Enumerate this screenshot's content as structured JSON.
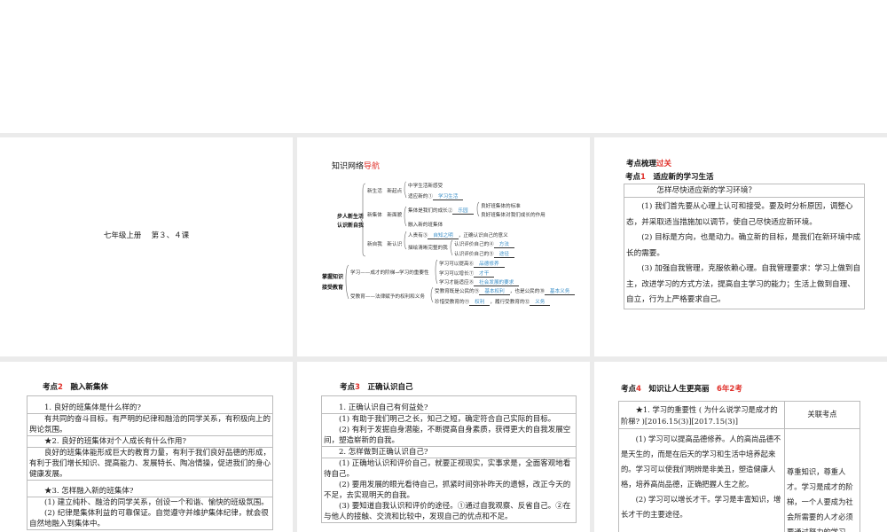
{
  "slides": [
    {
      "title": "七年级上册　 第３、４课"
    },
    {
      "title_a": "知识网络",
      "title_b": "导航",
      "mindmap": {
        "root1": [
          "步人新生活",
          "认识新自我"
        ],
        "b1": "新生活　新起点",
        "b1a": "中学生活新感受",
        "b1b": "适应新的①",
        "b1b_blank": "学习生活",
        "b2": "新集体　新面貌",
        "b2a": "集体是我们的成长②",
        "b2a_blank": "乐园",
        "b2a1": "良好班集体的标准",
        "b2a2": "良好班集体对我们成长的作用",
        "b2b": "融入新的班集体",
        "b3": "新自我　新认识",
        "b3a": "人贵有③",
        "b3a_blank": "自知之明",
        "b3a_tail": "，正确认识自己的意义",
        "b3b": "描绘清晰完整的我",
        "b3b1": "认识评价自己的④",
        "b3b1_blank": "方法",
        "b3b2": "认识评价自己的⑤",
        "b3b2_blank": "途径",
        "root2": [
          "掌握知识",
          "接受教育"
        ],
        "c1": "学习——成才的阶梯→学习的重要性",
        "c1a": "学习可以提高⑥",
        "c1a_blank": "品德修养",
        "c1b": "学习可以增长⑦",
        "c1b_blank": "才干",
        "c1c": "学习才能适应⑧",
        "c1c_blank": "社会发展的要求",
        "c2": "受教育——法律赋予的权利和义务",
        "c2a": "受教育既是公民的⑨",
        "c2a_blank": "基本权利",
        "c2a_mid": "，也是公民的⑩",
        "c2a_blank2": "基本义务",
        "c2b": "珍惜受教育的⑪",
        "c2b_blank": "权利",
        "c2b_mid": "，履行受教育的⑫",
        "c2b_blank2": "义务"
      }
    },
    {
      "title_a": "考点梳理",
      "title_b": "过关",
      "sub_a": "考点",
      "sub_num": "1",
      "sub_b": "适应新的学习生活",
      "rows": [
        "怎样尽快适应新的学习环境？",
        "(1) 我们首先要从心理上认可和接受。要及时分析原因，调整心态，并采取适当措施加以调节，使自己尽快适应新环境。",
        "(2) 目标是方向，也是动力。确立新的目标，是我们在新环境中成长的需要。",
        "(3) 加强自我管理，克服依赖心理。自我管理要求：学习上做到自主，改进学习的方式方法，提高自主学习的能力；生活上做到自理、自立，行为上严格要求自己。"
      ]
    },
    {
      "sub_a": "考点",
      "sub_num": "2",
      "sub_b": "融入新集体",
      "rows": [
        "1. 良好的班集体是什么样的?",
        "有共同的奋斗目标，有严明的纪律和融洽的同学关系，有积极向上的舆论氛围。",
        "★2. 良好的班集体对个人成长有什么作用?",
        "良好的班集体能形成巨大的教育力量，有利于我们良好品德的形成，有利于我们增长知识、提高能力、发展特长、陶冶情操，促进我们的身心健康发展。",
        "★3. 怎样融入新的班集体?",
        "(1) 建立纯朴、融洽的同学关系，创设一个和谐、愉快的班级氛围。",
        "(2) 纪律是集体利益的可靠保证。自觉遵守并维护集体纪律，就会很自然地融入到集体中。"
      ]
    },
    {
      "sub_a": "考点",
      "sub_num": "3",
      "sub_b": "正确认识自己",
      "rows": [
        "1. 正确认识自己有何益处?",
        "(1) 有助于我们明己之长，知己之短，确定符合自己实际的目标。",
        "(2) 有利于发掘自身潜能，不断提高自身素质，获得更大的自我发展空间，塑造崭新的自我。",
        "2. 怎样做到正确认识自己?",
        "(1) 正确地认识和评价自己，就要正视现实，实事求是，全面客观地看待自己。",
        "(2) 要用发展的眼光看待自己，抓紧时间弥补昨天的遗憾，改正今天的不足，去实现明天的自我。",
        "(3) 要知道自我认识和评价的途径。①通过自我观察、反省自己。②在与他人的接触、交流和比较中，发现自己的优点和不足。"
      ]
    },
    {
      "sub_a": "考点",
      "sub_num": "4",
      "sub_b": "知识让人生更亮丽",
      "badge": "6年2考",
      "head_left": "★1. 学习的重要性 ( 为什么说学习是成才的阶梯? )[2016.15(3)][2017.15(3)]",
      "head_right": "关联考点",
      "body_left": [
        "(1) 学习可以提高品德修养。人的高尚品德不是天生的，而是在后天的学习和生活中培养起来的。学习可以使我们明辨是非美丑，塑造健康人格，培养高尚品德，正确把握人生之舵。",
        "(2) 学习可以增长才干。学习是丰富知识，增长才干的主要途径。"
      ],
      "body_right": "尊重知识，尊重人才。学习是成才的阶梯，一个人要成为社会所需要的人才必须要通过努力的学习。"
    }
  ]
}
